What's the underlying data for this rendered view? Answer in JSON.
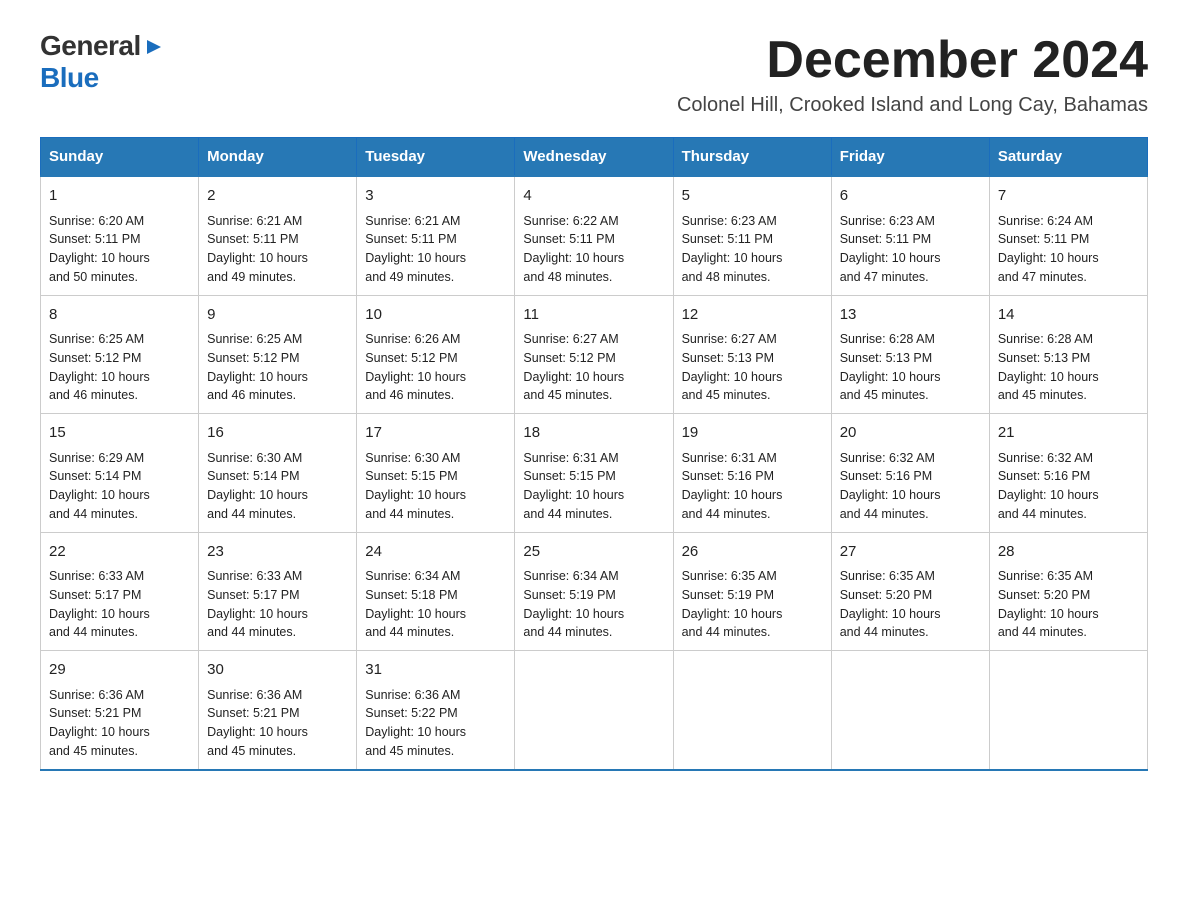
{
  "logo": {
    "general": "General",
    "blue": "Blue",
    "arrow": "▶"
  },
  "title": {
    "month": "December 2024",
    "location": "Colonel Hill, Crooked Island and Long Cay, Bahamas"
  },
  "weekdays": [
    "Sunday",
    "Monday",
    "Tuesday",
    "Wednesday",
    "Thursday",
    "Friday",
    "Saturday"
  ],
  "weeks": [
    [
      {
        "day": "1",
        "sunrise": "6:20 AM",
        "sunset": "5:11 PM",
        "daylight": "10 hours and 50 minutes."
      },
      {
        "day": "2",
        "sunrise": "6:21 AM",
        "sunset": "5:11 PM",
        "daylight": "10 hours and 49 minutes."
      },
      {
        "day": "3",
        "sunrise": "6:21 AM",
        "sunset": "5:11 PM",
        "daylight": "10 hours and 49 minutes."
      },
      {
        "day": "4",
        "sunrise": "6:22 AM",
        "sunset": "5:11 PM",
        "daylight": "10 hours and 48 minutes."
      },
      {
        "day": "5",
        "sunrise": "6:23 AM",
        "sunset": "5:11 PM",
        "daylight": "10 hours and 48 minutes."
      },
      {
        "day": "6",
        "sunrise": "6:23 AM",
        "sunset": "5:11 PM",
        "daylight": "10 hours and 47 minutes."
      },
      {
        "day": "7",
        "sunrise": "6:24 AM",
        "sunset": "5:11 PM",
        "daylight": "10 hours and 47 minutes."
      }
    ],
    [
      {
        "day": "8",
        "sunrise": "6:25 AM",
        "sunset": "5:12 PM",
        "daylight": "10 hours and 46 minutes."
      },
      {
        "day": "9",
        "sunrise": "6:25 AM",
        "sunset": "5:12 PM",
        "daylight": "10 hours and 46 minutes."
      },
      {
        "day": "10",
        "sunrise": "6:26 AM",
        "sunset": "5:12 PM",
        "daylight": "10 hours and 46 minutes."
      },
      {
        "day": "11",
        "sunrise": "6:27 AM",
        "sunset": "5:12 PM",
        "daylight": "10 hours and 45 minutes."
      },
      {
        "day": "12",
        "sunrise": "6:27 AM",
        "sunset": "5:13 PM",
        "daylight": "10 hours and 45 minutes."
      },
      {
        "day": "13",
        "sunrise": "6:28 AM",
        "sunset": "5:13 PM",
        "daylight": "10 hours and 45 minutes."
      },
      {
        "day": "14",
        "sunrise": "6:28 AM",
        "sunset": "5:13 PM",
        "daylight": "10 hours and 45 minutes."
      }
    ],
    [
      {
        "day": "15",
        "sunrise": "6:29 AM",
        "sunset": "5:14 PM",
        "daylight": "10 hours and 44 minutes."
      },
      {
        "day": "16",
        "sunrise": "6:30 AM",
        "sunset": "5:14 PM",
        "daylight": "10 hours and 44 minutes."
      },
      {
        "day": "17",
        "sunrise": "6:30 AM",
        "sunset": "5:15 PM",
        "daylight": "10 hours and 44 minutes."
      },
      {
        "day": "18",
        "sunrise": "6:31 AM",
        "sunset": "5:15 PM",
        "daylight": "10 hours and 44 minutes."
      },
      {
        "day": "19",
        "sunrise": "6:31 AM",
        "sunset": "5:16 PM",
        "daylight": "10 hours and 44 minutes."
      },
      {
        "day": "20",
        "sunrise": "6:32 AM",
        "sunset": "5:16 PM",
        "daylight": "10 hours and 44 minutes."
      },
      {
        "day": "21",
        "sunrise": "6:32 AM",
        "sunset": "5:16 PM",
        "daylight": "10 hours and 44 minutes."
      }
    ],
    [
      {
        "day": "22",
        "sunrise": "6:33 AM",
        "sunset": "5:17 PM",
        "daylight": "10 hours and 44 minutes."
      },
      {
        "day": "23",
        "sunrise": "6:33 AM",
        "sunset": "5:17 PM",
        "daylight": "10 hours and 44 minutes."
      },
      {
        "day": "24",
        "sunrise": "6:34 AM",
        "sunset": "5:18 PM",
        "daylight": "10 hours and 44 minutes."
      },
      {
        "day": "25",
        "sunrise": "6:34 AM",
        "sunset": "5:19 PM",
        "daylight": "10 hours and 44 minutes."
      },
      {
        "day": "26",
        "sunrise": "6:35 AM",
        "sunset": "5:19 PM",
        "daylight": "10 hours and 44 minutes."
      },
      {
        "day": "27",
        "sunrise": "6:35 AM",
        "sunset": "5:20 PM",
        "daylight": "10 hours and 44 minutes."
      },
      {
        "day": "28",
        "sunrise": "6:35 AM",
        "sunset": "5:20 PM",
        "daylight": "10 hours and 44 minutes."
      }
    ],
    [
      {
        "day": "29",
        "sunrise": "6:36 AM",
        "sunset": "5:21 PM",
        "daylight": "10 hours and 45 minutes."
      },
      {
        "day": "30",
        "sunrise": "6:36 AM",
        "sunset": "5:21 PM",
        "daylight": "10 hours and 45 minutes."
      },
      {
        "day": "31",
        "sunrise": "6:36 AM",
        "sunset": "5:22 PM",
        "daylight": "10 hours and 45 minutes."
      },
      null,
      null,
      null,
      null
    ]
  ],
  "labels": {
    "sunrise": "Sunrise:",
    "sunset": "Sunset:",
    "daylight": "Daylight:"
  }
}
